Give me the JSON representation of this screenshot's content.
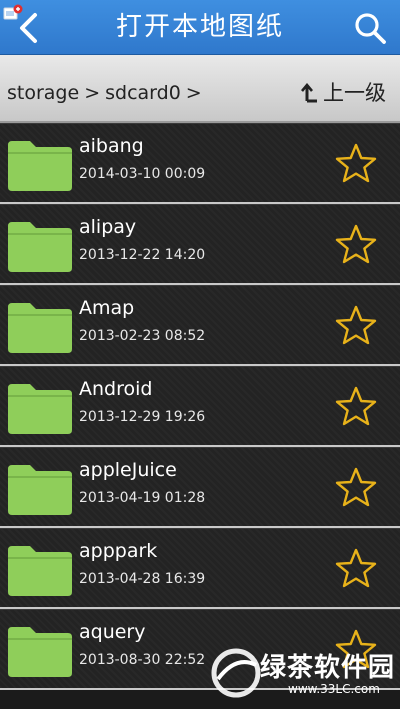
{
  "header": {
    "title": "打开本地图纸",
    "back_icon": "chevron-left-icon",
    "search_icon": "search-icon",
    "accent": "#2f78cc"
  },
  "pathbar": {
    "crumbs": [
      "storage",
      "sdcard0"
    ],
    "separator": ">",
    "up_label": "上一级",
    "up_icon": "arrow-up-return-icon"
  },
  "files": [
    {
      "name": "aibang",
      "date": "2014-03-10 00:09"
    },
    {
      "name": "alipay",
      "date": "2013-12-22 14:20"
    },
    {
      "name": "Amap",
      "date": "2013-02-23 08:52"
    },
    {
      "name": "Android",
      "date": "2013-12-29 19:26"
    },
    {
      "name": "appleJuice",
      "date": "2013-04-19 01:28"
    },
    {
      "name": "apppark",
      "date": "2013-04-28 16:39"
    },
    {
      "name": "aquery",
      "date": "2013-08-30 22:52"
    }
  ],
  "colors": {
    "folder": "#8fce5a",
    "star": "#e8b21a",
    "row_background": "#232323",
    "row_divider": "#c9c9c9"
  },
  "watermark": {
    "text": "绿茶软件园",
    "url": "www.33LC.com"
  }
}
